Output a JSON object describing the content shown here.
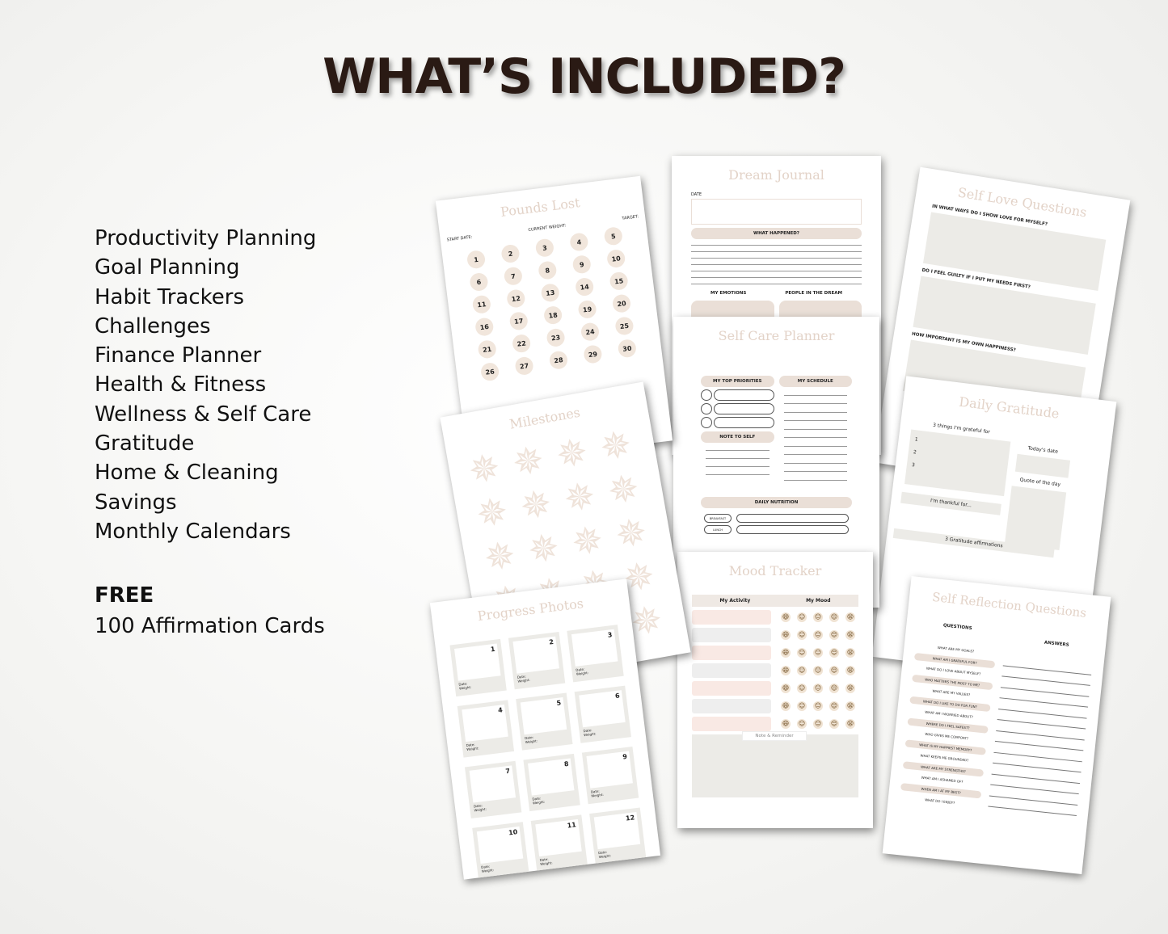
{
  "heading": "WHAT’S INCLUDED?",
  "features": [
    "Productivity Planning",
    "Goal Planning",
    "Habit Trackers",
    "Challenges",
    "Finance Planner",
    "Health & Fitness",
    "Wellness & Self Care",
    "Gratitude",
    "Home & Cleaning",
    "Savings",
    "Monthly Calendars"
  ],
  "bonus": {
    "label": "FREE",
    "item": "100 Affirmation Cards"
  },
  "colors": {
    "title": "#2a1a14",
    "page_title": "#e3d3c8",
    "pill": "#eadfd7",
    "box": "#ecebe7",
    "pink_row": "#f9e9e4"
  },
  "pages": {
    "pounds_lost": {
      "title": "Pounds Lost",
      "start_date": "START DATE:",
      "current_weight": "CURRENT WEIGHT:",
      "target": "TARGET:",
      "numbers": [
        "1",
        "2",
        "3",
        "4",
        "5",
        "6",
        "7",
        "8",
        "9",
        "10",
        "11",
        "12",
        "13",
        "14",
        "15",
        "16",
        "17",
        "18",
        "19",
        "20",
        "21",
        "22",
        "23",
        "24",
        "25",
        "26",
        "27",
        "28",
        "29",
        "30"
      ]
    },
    "milestones": {
      "title": "Milestones"
    },
    "progress_photos": {
      "title": "Progress Photos",
      "date_label": "Date:",
      "weight_label": "Weight:",
      "numbers": [
        "1",
        "2",
        "3",
        "4",
        "5",
        "6",
        "7",
        "8",
        "9",
        "10",
        "11",
        "12"
      ]
    },
    "dream_journal": {
      "title": "Dream Journal",
      "date": "DATE",
      "what_happened": "WHAT HAPPENED?",
      "emotions": "MY EMOTIONS",
      "people": "PEOPLE IN THE DREAM"
    },
    "self_care": {
      "title": "Self Care Planner",
      "priorities": "MY TOP PRIORITIES",
      "schedule": "MY SCHEDULE",
      "note": "NOTE TO SELF",
      "nutrition": "DAILY NUTRITION",
      "meals": [
        "BREAKFAST",
        "LUNCH"
      ]
    },
    "mood_tracker": {
      "title": "Mood Tracker",
      "activity": "My Activity",
      "mood": "My Mood",
      "note": "Note & Reminder",
      "moods": [
        "grinning-icon",
        "smile-icon",
        "neutral-icon",
        "relieved-icon",
        "distressed-icon"
      ]
    },
    "self_love": {
      "title": "Self Love Questions",
      "questions": [
        "IN WHAT WAYS DO I SHOW LOVE FOR MYSELF?",
        "DO I FEEL GUILTY IF I PUT MY NEEDS FIRST?",
        "HOW IMPORTANT IS MY OWN HAPPINESS?"
      ]
    },
    "gratitude": {
      "title": "Daily Gratitude",
      "grateful": "3 things I'm grateful for",
      "nums": [
        "1",
        "2",
        "3"
      ],
      "todays_date": "Today's date",
      "quote": "Quote of the day",
      "thankful": "I'm thankful for...",
      "affirmations": "3 Gratitude affirmations"
    },
    "self_reflection": {
      "title": "Self Reflection Questions",
      "questions_header": "QUESTIONS",
      "answers_header": "ANSWERS",
      "questions": [
        "WHAT ARE MY GOALS?",
        "WHAT AM I GRATEFUL FOR?",
        "WHAT DO I LOVE ABOUT MYSELF?",
        "WHO MATTERS THE MOST TO ME?",
        "WHAT ARE MY VALUES?",
        "WHAT DO I LIKE TO DO FOR FUN?",
        "WHAT AM I WORRIED ABOUT?",
        "WHERE DO I FEEL SAFEST?",
        "WHO GIVES ME COMFORT?",
        "WHAT IS MY HAPPIEST MEMORY?",
        "WHAT KEEPS ME GROUNDED?",
        "WHAT ARE MY STRENGTHS?",
        "WHAT AM I ASHAMED OF?",
        "WHEN AM I AT MY BEST?",
        "WHAT DO I ENJOY?"
      ]
    }
  }
}
